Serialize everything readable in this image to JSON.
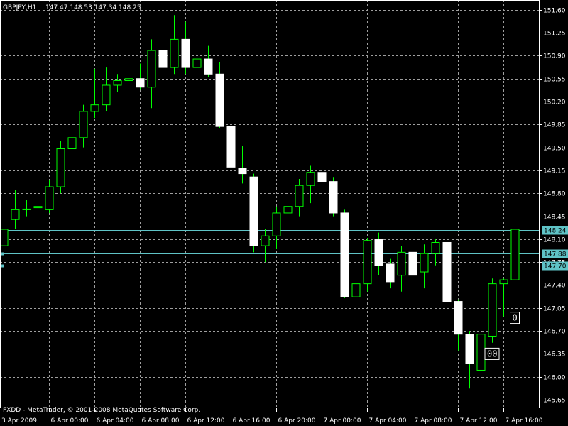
{
  "header": {
    "symbol": "GBPJPY,H1",
    "ohlc": "147.47 148.53 147.34 148.25"
  },
  "footer": {
    "copyright": "FXDD - MetaTrader, © 2001-2008 MetaQuotes Software Corp."
  },
  "colors": {
    "background": "#000000",
    "bull": "#00ff00",
    "bear": "#ffffff",
    "grid": "#9e9e9e",
    "line": "#5fc3c6",
    "text": "#ffffff"
  },
  "chart_data": {
    "type": "candlestick",
    "ylim": [
      145.52,
      151.75
    ],
    "y_ticks": [
      151.6,
      151.25,
      150.9,
      150.55,
      150.2,
      149.85,
      149.5,
      149.15,
      148.8,
      148.45,
      148.1,
      147.75,
      147.4,
      147.05,
      146.7,
      146.35,
      146.0,
      145.65
    ],
    "x_ticks": [
      "3 Apr 2009",
      "6 Apr 00:00",
      "6 Apr 04:00",
      "6 Apr 08:00",
      "6 Apr 12:00",
      "6 Apr 16:00",
      "6 Apr 20:00",
      "7 Apr 00:00",
      "7 Apr 04:00",
      "7 Apr 08:00",
      "7 Apr 12:00",
      "7 Apr 16:00"
    ],
    "x_tick_slots": [
      0,
      4,
      8,
      12,
      16,
      20,
      24,
      28,
      32,
      36,
      40,
      44
    ],
    "candles": [
      {
        "o": 148.0,
        "h": 148.3,
        "l": 147.85,
        "c": 148.25
      },
      {
        "o": 148.4,
        "h": 148.85,
        "l": 148.25,
        "c": 148.55
      },
      {
        "o": 148.55,
        "h": 148.7,
        "l": 148.45,
        "c": 148.56
      },
      {
        "o": 148.58,
        "h": 148.7,
        "l": 148.55,
        "c": 148.6
      },
      {
        "o": 148.55,
        "h": 149.0,
        "l": 148.5,
        "c": 148.9
      },
      {
        "o": 148.9,
        "h": 149.6,
        "l": 148.8,
        "c": 149.48
      },
      {
        "o": 149.48,
        "h": 149.75,
        "l": 149.3,
        "c": 149.65
      },
      {
        "o": 149.65,
        "h": 150.15,
        "l": 149.5,
        "c": 150.05
      },
      {
        "o": 150.05,
        "h": 150.7,
        "l": 149.95,
        "c": 150.15
      },
      {
        "o": 150.15,
        "h": 150.72,
        "l": 150.05,
        "c": 150.45
      },
      {
        "o": 150.45,
        "h": 150.62,
        "l": 150.35,
        "c": 150.52
      },
      {
        "o": 150.52,
        "h": 150.8,
        "l": 150.42,
        "c": 150.55
      },
      {
        "o": 150.55,
        "h": 150.78,
        "l": 150.38,
        "c": 150.42
      },
      {
        "o": 150.42,
        "h": 151.15,
        "l": 150.1,
        "c": 150.98
      },
      {
        "o": 150.98,
        "h": 151.2,
        "l": 150.6,
        "c": 150.72
      },
      {
        "o": 150.72,
        "h": 151.52,
        "l": 150.62,
        "c": 151.15
      },
      {
        "o": 151.15,
        "h": 151.42,
        "l": 150.62,
        "c": 150.72
      },
      {
        "o": 150.72,
        "h": 151.02,
        "l": 150.58,
        "c": 150.85
      },
      {
        "o": 150.85,
        "h": 151.05,
        "l": 150.58,
        "c": 150.62
      },
      {
        "o": 150.62,
        "h": 150.8,
        "l": 149.8,
        "c": 149.82
      },
      {
        "o": 149.82,
        "h": 149.92,
        "l": 148.95,
        "c": 149.2
      },
      {
        "o": 149.18,
        "h": 149.52,
        "l": 148.95,
        "c": 149.1
      },
      {
        "o": 149.05,
        "h": 149.1,
        "l": 147.9,
        "c": 148.0
      },
      {
        "o": 148.0,
        "h": 148.25,
        "l": 147.75,
        "c": 148.15
      },
      {
        "o": 148.15,
        "h": 148.6,
        "l": 147.95,
        "c": 148.5
      },
      {
        "o": 148.5,
        "h": 148.7,
        "l": 148.4,
        "c": 148.6
      },
      {
        "o": 148.6,
        "h": 149.02,
        "l": 148.45,
        "c": 148.92
      },
      {
        "o": 148.92,
        "h": 149.22,
        "l": 148.65,
        "c": 149.12
      },
      {
        "o": 149.12,
        "h": 149.2,
        "l": 148.8,
        "c": 148.98
      },
      {
        "o": 148.98,
        "h": 149.05,
        "l": 148.45,
        "c": 148.5
      },
      {
        "o": 148.5,
        "h": 148.55,
        "l": 147.2,
        "c": 147.22
      },
      {
        "o": 147.22,
        "h": 147.5,
        "l": 146.85,
        "c": 147.42
      },
      {
        "o": 147.42,
        "h": 148.12,
        "l": 147.3,
        "c": 148.08
      },
      {
        "o": 148.1,
        "h": 148.2,
        "l": 147.55,
        "c": 147.7
      },
      {
        "o": 147.72,
        "h": 147.8,
        "l": 147.35,
        "c": 147.45
      },
      {
        "o": 147.55,
        "h": 148.0,
        "l": 147.3,
        "c": 147.9
      },
      {
        "o": 147.9,
        "h": 147.98,
        "l": 147.5,
        "c": 147.55
      },
      {
        "o": 147.6,
        "h": 148.02,
        "l": 147.35,
        "c": 147.88
      },
      {
        "o": 147.88,
        "h": 148.1,
        "l": 147.7,
        "c": 148.05
      },
      {
        "o": 148.05,
        "h": 148.1,
        "l": 147.05,
        "c": 147.15
      },
      {
        "o": 147.15,
        "h": 147.18,
        "l": 146.4,
        "c": 146.65
      },
      {
        "o": 146.65,
        "h": 146.7,
        "l": 145.82,
        "c": 146.2
      },
      {
        "o": 146.1,
        "h": 146.7,
        "l": 146.0,
        "c": 146.65
      },
      {
        "o": 146.62,
        "h": 147.5,
        "l": 146.52,
        "c": 147.42
      },
      {
        "o": 147.42,
        "h": 147.5,
        "l": 146.92,
        "c": 147.48
      },
      {
        "o": 147.48,
        "h": 148.53,
        "l": 147.34,
        "c": 148.25
      }
    ],
    "hlines": [
      {
        "value": 148.24,
        "label": "148.24"
      },
      {
        "value": 147.88,
        "label": "147.88"
      },
      {
        "value": 147.7,
        "label": "147.70"
      }
    ],
    "annotations": [
      {
        "text": "0",
        "slot": 45,
        "value": 146.9
      },
      {
        "text": "00",
        "slot": 43,
        "value": 146.35
      }
    ],
    "grid": true
  }
}
